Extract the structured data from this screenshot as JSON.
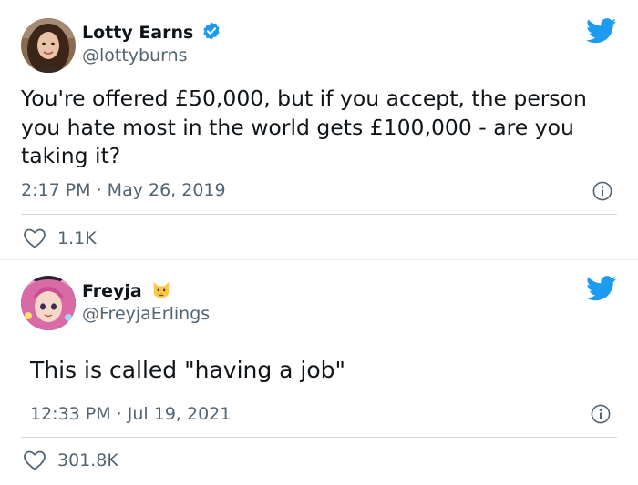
{
  "tweets": [
    {
      "name": "Lotty Earns",
      "handle": "@lottyburns",
      "text": "You're offered £50,000, but if you accept, the person you hate most in the world gets £100,000 - are you taking it?",
      "time": "2:17 PM · May 26, 2019",
      "likes": "1.1K",
      "verified": true
    },
    {
      "name": "Freyja",
      "handle": "@FreyjaErlings",
      "text": "This is called \"having a job\"",
      "time": "12:33 PM · Jul 19, 2021",
      "likes": "301.8K",
      "badge_emoji": "cat-face"
    }
  ],
  "colors": {
    "twitter_blue": "#1d9bf0",
    "text": "#0f1419",
    "secondary": "#536471"
  }
}
